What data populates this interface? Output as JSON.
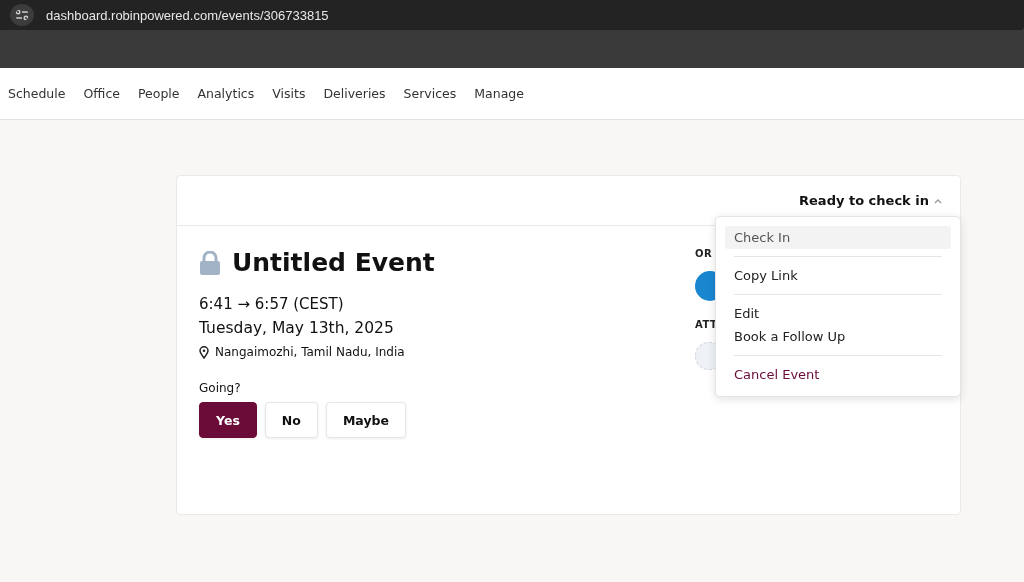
{
  "browser": {
    "url": "dashboard.robinpowered.com/events/306733815"
  },
  "nav": [
    {
      "label": "Schedule"
    },
    {
      "label": "Office"
    },
    {
      "label": "People"
    },
    {
      "label": "Analytics"
    },
    {
      "label": "Visits"
    },
    {
      "label": "Deliveries"
    },
    {
      "label": "Services"
    },
    {
      "label": "Manage"
    }
  ],
  "event": {
    "status": "Ready to check in",
    "private": true,
    "title": "Untitled Event",
    "time": "6:41 → 6:57 (CEST)",
    "date": "Tuesday, May 13th, 2025",
    "location": "Nangaimozhi, Tamil Nadu, India",
    "going_label": "Going?",
    "rsvp": [
      {
        "label": "Yes",
        "selected": true
      },
      {
        "label": "No",
        "selected": false
      },
      {
        "label": "Maybe",
        "selected": false
      }
    ],
    "side_headings": [
      "OR",
      "ATT"
    ]
  },
  "menu": {
    "expanded": true,
    "groups": [
      [
        {
          "label": "Check In",
          "kind": "normal",
          "selected": true
        }
      ],
      [
        {
          "label": "Copy Link",
          "kind": "normal",
          "selected": false
        }
      ],
      [
        {
          "label": "Edit",
          "kind": "normal",
          "selected": false
        },
        {
          "label": "Book a Follow Up",
          "kind": "normal",
          "selected": false
        }
      ],
      [
        {
          "label": "Cancel Event",
          "kind": "danger",
          "selected": false
        }
      ]
    ]
  }
}
